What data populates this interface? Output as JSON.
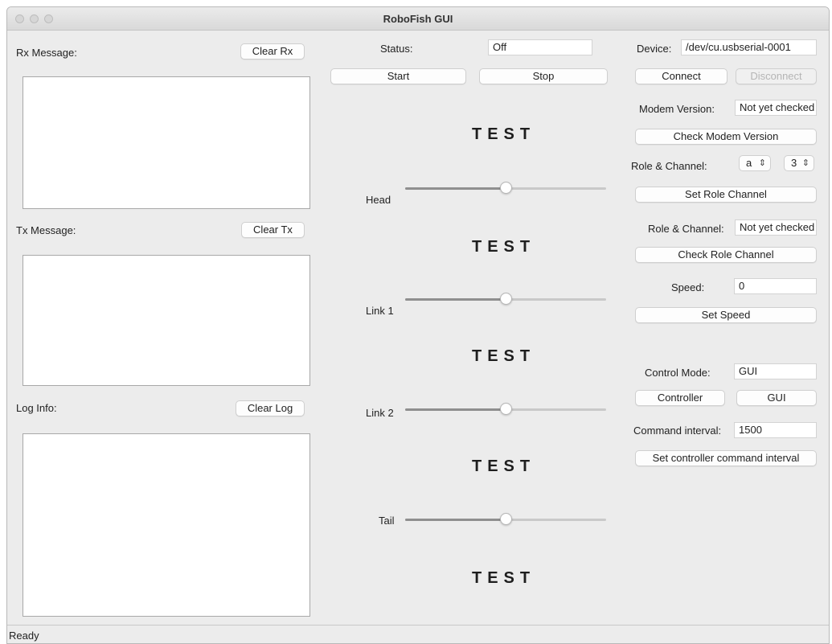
{
  "window": {
    "title": "RoboFish GUI"
  },
  "left": {
    "rx_label": "Rx Message:",
    "rx_clear": "Clear Rx",
    "tx_label": "Tx Message:",
    "tx_clear": "Clear Tx",
    "log_label": "Log Info:",
    "log_clear": "Clear Log"
  },
  "middle": {
    "status_label": "Status:",
    "status_value": "Off",
    "start": "Start",
    "stop": "Stop",
    "test_text": "TEST",
    "sliders": [
      {
        "label": "Head",
        "value": 0.5
      },
      {
        "label": "Link 1",
        "value": 0.5
      },
      {
        "label": "Link 2",
        "value": 0.5
      },
      {
        "label": "Tail",
        "value": 0.5
      }
    ]
  },
  "right": {
    "device_label": "Device:",
    "device_value": "/dev/cu.usbserial-0001",
    "connect": "Connect",
    "disconnect": "Disconnect",
    "modem_label": "Modem Version:",
    "modem_value": "Not yet checked",
    "check_modem": "Check Modem Version",
    "role_label": "Role & Channel:",
    "role_value": "a",
    "channel_value": "3",
    "set_role": "Set Role Channel",
    "role2_label": "Role & Channel:",
    "role2_value": "Not yet checked",
    "check_role": "Check Role  Channel",
    "speed_label": "Speed:",
    "speed_value": "0",
    "set_speed": "Set Speed",
    "control_label": "Control Mode:",
    "control_value": "GUI",
    "controller_btn": "Controller",
    "gui_btn": "GUI",
    "interval_label": "Command interval:",
    "interval_value": "1500",
    "set_interval": "Set controller command interval"
  },
  "statusbar": {
    "text": "Ready"
  }
}
